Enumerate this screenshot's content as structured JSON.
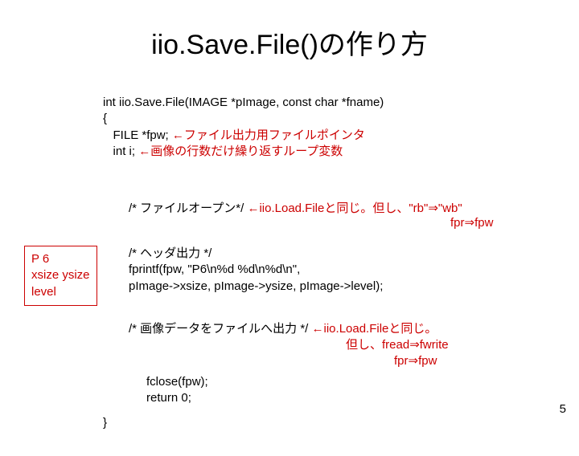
{
  "title": "iio.Save.File()の作り方",
  "func_sig": "int iio.Save.File(IMAGE *pImage, const char *fname)",
  "brace_open": "{",
  "decl_file": "FILE *fpw; ",
  "decl_file_comment": "←ファイル出力用ファイルポインタ",
  "decl_i": "int i;    ",
  "decl_i_comment": "←画像の行数だけ繰り返すループ変数",
  "open_label": "/* ファイルオープン*/ ",
  "open_red1": "←iio.Load.Fileと同じ。但し、\"rb\"⇒\"wb\"",
  "open_red2": "fpr⇒fpw",
  "sidebar_l1": "P 6",
  "sidebar_l2": "xsize  ysize",
  "sidebar_l3": "level",
  "header_comment": "/* ヘッダ出力 */",
  "header_l1": "fprintf(fpw, \"P6\\n%d %d\\n%d\\n\",",
  "header_l2": "    pImage->xsize, pImage->ysize, pImage->level);",
  "imgdata_label": "/* 画像データをファイルへ出力 */ ",
  "imgdata_red1": "←iio.Load.Fileと同じ。",
  "imgdata_red2": "但し、fread⇒fwrite",
  "imgdata_red3": "fpr⇒fpw",
  "close_l1": "fclose(fpw);",
  "close_l2": "return 0;",
  "brace_close": "}",
  "page_num": "5"
}
